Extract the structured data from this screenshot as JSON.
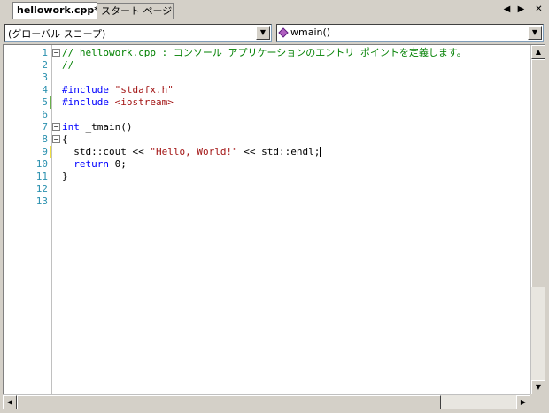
{
  "tabs": [
    {
      "label": "hellowork.cpp*",
      "active": true
    },
    {
      "label": "スタート ページ",
      "active": false
    }
  ],
  "tab_controls": {
    "scroll_left": "◀",
    "scroll_right": "▶",
    "close": "✕"
  },
  "navbar": {
    "scope_combo": "(グローバル スコープ)",
    "member_combo": "wmain()",
    "dropdown_arrow": "▼"
  },
  "line_numbers": [
    "1",
    "2",
    "3",
    "4",
    "5",
    "6",
    "7",
    "8",
    "9",
    "10",
    "11",
    "12",
    "13"
  ],
  "code": {
    "l1_comment": "// hellowork.cpp : コンソール アプリケーションのエントリ ポイントを定義します。",
    "l2_comment": "//",
    "l3": "",
    "l4_directive": "#include",
    "l4_file": "\"stdafx.h\"",
    "l5_directive": "#include",
    "l5_file": "<iostream>",
    "l6": "",
    "l7_kw": "int",
    "l7_rest": " _tmain()",
    "l8": "{",
    "l9_pre": "  std::cout << ",
    "l9_str": "\"Hello, World!\"",
    "l9_post": " << std::endl;",
    "l10_kw": "return",
    "l10_rest": " 0;",
    "l11": "}",
    "l12": "",
    "l13": ""
  },
  "fold_markers": {
    "collapse": "−"
  },
  "scrollbar": {
    "up": "▲",
    "down": "▼",
    "left": "◀",
    "right": "▶"
  },
  "colors": {
    "comment": "#008000",
    "keyword": "#0000ff",
    "string": "#a31515",
    "line_number": "#2b91af",
    "changed_saved": "#6ab04c",
    "changed_unsaved": "#f0e040"
  }
}
